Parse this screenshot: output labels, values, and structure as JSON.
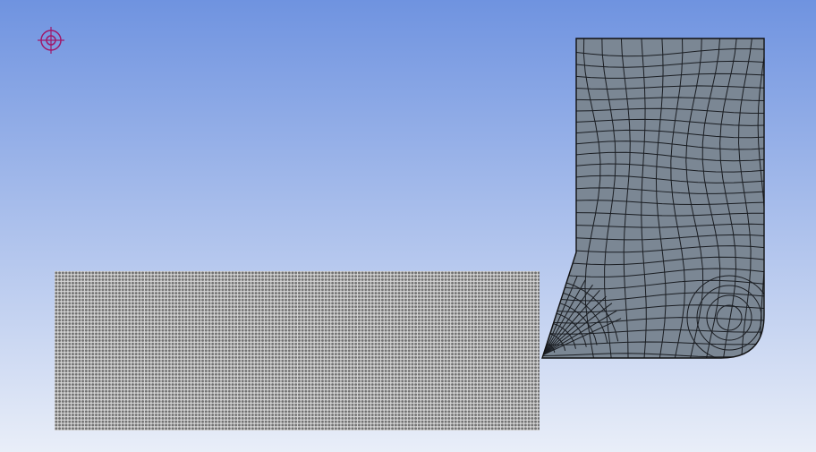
{
  "viewport": {
    "background_top": "#6f93e0",
    "background_bottom": "#e9eef8"
  },
  "origin_marker": {
    "icon": "crosshair-target-icon",
    "color": "#a0186a"
  },
  "workpiece": {
    "fill": "#d6d6d6",
    "particle_color": "#6f6f6f",
    "particle_grid": {
      "cols": 145,
      "rows": 47
    }
  },
  "tool": {
    "fill": "#7b8794",
    "mesh_line_color": "#1a1d22",
    "outline_color": "#111111"
  }
}
